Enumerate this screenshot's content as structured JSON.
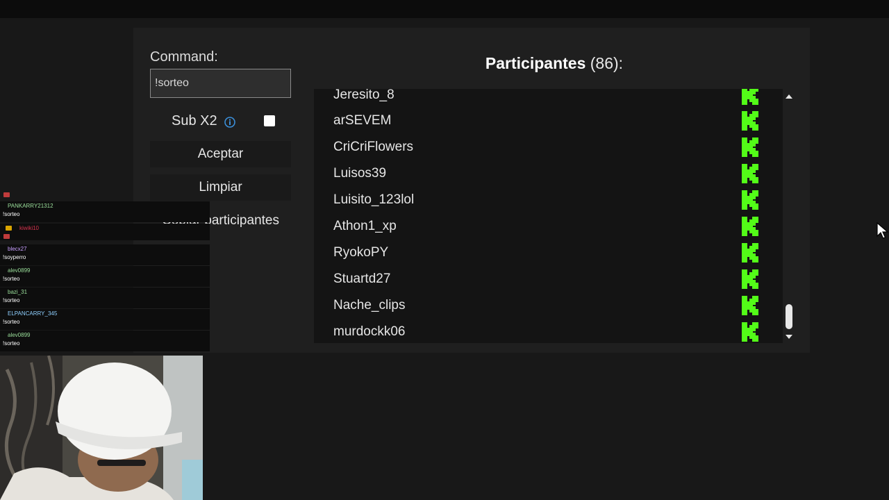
{
  "command": {
    "label": "Command:",
    "value": "!sorteo"
  },
  "sub_option": {
    "label": "Sub X2",
    "icon": "info-icon",
    "checked": false
  },
  "buttons": {
    "accept": "Aceptar",
    "clear": "Limpiar",
    "copy": "Copiar participantes"
  },
  "participants": {
    "title": "Participantes",
    "count": "(86):",
    "platform_icon": "kick-icon",
    "platform_color": "#53fc18",
    "items": [
      {
        "name": "Jeresito_8"
      },
      {
        "name": "arSEVEM"
      },
      {
        "name": "CriCriFlowers"
      },
      {
        "name": "Luisos39"
      },
      {
        "name": "Luisito_123lol"
      },
      {
        "name": "Athon1_xp"
      },
      {
        "name": "RyokoPY"
      },
      {
        "name": "Stuartd27"
      },
      {
        "name": "Nache_clips"
      },
      {
        "name": "murdockk06"
      }
    ]
  },
  "chat_overlay": {
    "messages": [
      {
        "user": "PANKARRY21312",
        "text": "!sorteo"
      },
      {
        "user": "kiwiki10",
        "text": ""
      },
      {
        "user": "blecx27",
        "text": "!soyperro"
      },
      {
        "user": "alev0899",
        "text": "!sorteo"
      },
      {
        "user": "bazi_31",
        "text": "!sorteo"
      },
      {
        "user": "ELPANCARRY_345",
        "text": "!sorteo"
      },
      {
        "user": "alev0899",
        "text": "!sorteo"
      }
    ]
  },
  "colors": {
    "background": "#181818",
    "panel": "#1f1f1f",
    "kick_green": "#53fc18",
    "info_blue": "#3b8fd9"
  }
}
